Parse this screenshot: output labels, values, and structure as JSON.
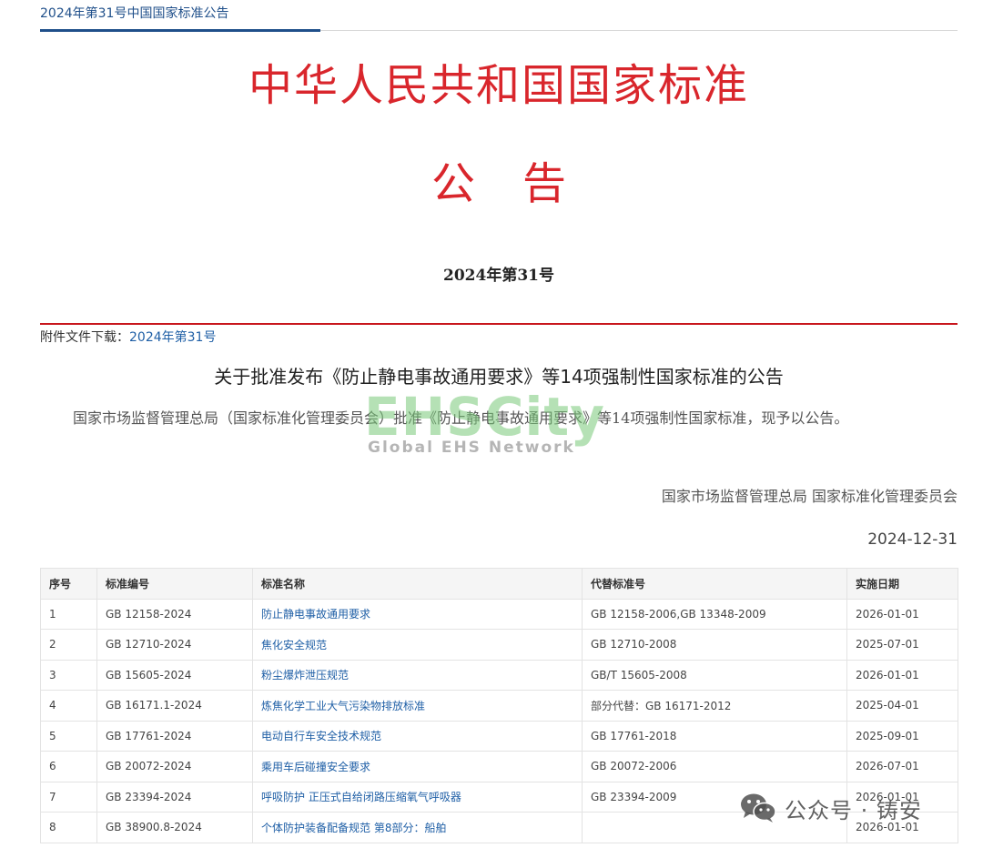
{
  "breadcrumb": {
    "title": "2024年第31号中国国家标准公告"
  },
  "header": {
    "main_title": "中华人民共和国国家标准",
    "notice_title": "公告",
    "issue_no": "2024年第31号"
  },
  "attachment": {
    "label": "附件文件下载：",
    "link": "2024年第31号"
  },
  "announcement": {
    "title": "关于批准发布《防止静电事故通用要求》等14项强制性国家标准的公告",
    "body": "国家市场监督管理总局（国家标准化管理委员会）批准《防止静电事故通用要求》等14项强制性国家标准，现予以公告。",
    "signer": "国家市场监督管理总局 国家标准化管理委员会",
    "date": "2024-12-31"
  },
  "watermark": {
    "brand": "EHSCity",
    "subtitle": "Global EHS Network"
  },
  "wechat": {
    "text": "公众号 · 铸安",
    "icon": "wechat-icon"
  },
  "table": {
    "headers": [
      "序号",
      "标准编号",
      "标准名称",
      "代替标准号",
      "实施日期"
    ],
    "rows": [
      [
        "1",
        "GB 12158-2024",
        "防止静电事故通用要求",
        "GB 12158-2006,GB 13348-2009",
        "2026-01-01"
      ],
      [
        "2",
        "GB 12710-2024",
        "焦化安全规范",
        "GB 12710-2008",
        "2025-07-01"
      ],
      [
        "3",
        "GB 15605-2024",
        "粉尘爆炸泄压规范",
        "GB/T 15605-2008",
        "2026-01-01"
      ],
      [
        "4",
        "GB 16171.1-2024",
        "炼焦化学工业大气污染物排放标准",
        "部分代替：GB 16171-2012",
        "2025-04-01"
      ],
      [
        "5",
        "GB 17761-2024",
        "电动自行车安全技术规范",
        "GB 17761-2018",
        "2025-09-01"
      ],
      [
        "6",
        "GB 20072-2024",
        "乘用车后碰撞安全要求",
        "GB 20072-2006",
        "2026-07-01"
      ],
      [
        "7",
        "GB 23394-2024",
        "呼吸防护 正压式自给闭路压缩氧气呼吸器",
        "GB 23394-2009",
        "2026-01-01"
      ],
      [
        "8",
        "GB 38900.8-2024",
        "个体防护装备配备规范 第8部分：船舶",
        "",
        "2026-01-01"
      ]
    ]
  },
  "colors": {
    "title_red": "#d9262c",
    "rule_red": "#c8161d",
    "link_blue": "#1f5fa6",
    "crumb_blue": "#1f4f8a"
  }
}
